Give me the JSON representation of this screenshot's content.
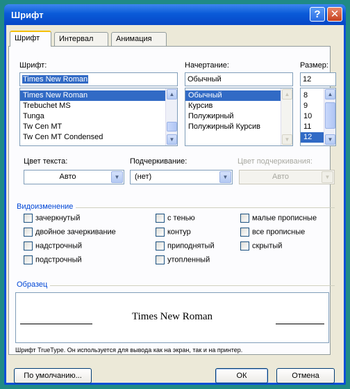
{
  "dialog": {
    "title": "Шрифт"
  },
  "titlebar": {
    "help_glyph": "?",
    "close_glyph": "✕"
  },
  "tabs": [
    {
      "label": "Шрифт",
      "active": true
    },
    {
      "label": "Интервал",
      "active": false
    },
    {
      "label": "Анимация",
      "active": false
    }
  ],
  "font": {
    "label": "Шрифт:",
    "value": "Times New Roman",
    "list": [
      "Times New Roman",
      "Trebuchet MS",
      "Tunga",
      "Tw Cen MT",
      "Tw Cen MT Condensed"
    ],
    "selected_index": 0
  },
  "style": {
    "label": "Начертание:",
    "value": "Обычный",
    "list": [
      "Обычный",
      "Курсив",
      "Полужирный",
      "Полужирный Курсив"
    ],
    "selected_index": 0
  },
  "size": {
    "label": "Размер:",
    "value": "12",
    "list": [
      "8",
      "9",
      "10",
      "11",
      "12"
    ],
    "selected_index": 4
  },
  "color": {
    "label": "Цвет текста:",
    "value": "Авто"
  },
  "underline": {
    "label": "Подчеркивание:",
    "value": "(нет)"
  },
  "underline_color": {
    "label": "Цвет подчеркивания:",
    "value": "Авто",
    "disabled": true
  },
  "effects": {
    "title": "Видоизменение",
    "col1": [
      "зачеркнутый",
      "двойное зачеркивание",
      "надстрочный",
      "подстрочный"
    ],
    "col2": [
      "с тенью",
      "контур",
      "приподнятый",
      "утопленный"
    ],
    "col3": [
      "малые прописные",
      "все прописные",
      "скрытый"
    ]
  },
  "preview": {
    "title": "Образец",
    "sample_text": "Times New Roman",
    "note": "Шрифт TrueType. Он используется для вывода как на экран, так и на принтер."
  },
  "buttons": {
    "default": "По умолчанию...",
    "ok": "ОК",
    "cancel": "Отмена"
  },
  "colors": {
    "titlebar": "#0a5bd8",
    "background": "#1f8a86",
    "accent": "#316ac5",
    "group_title": "#0046d5"
  }
}
